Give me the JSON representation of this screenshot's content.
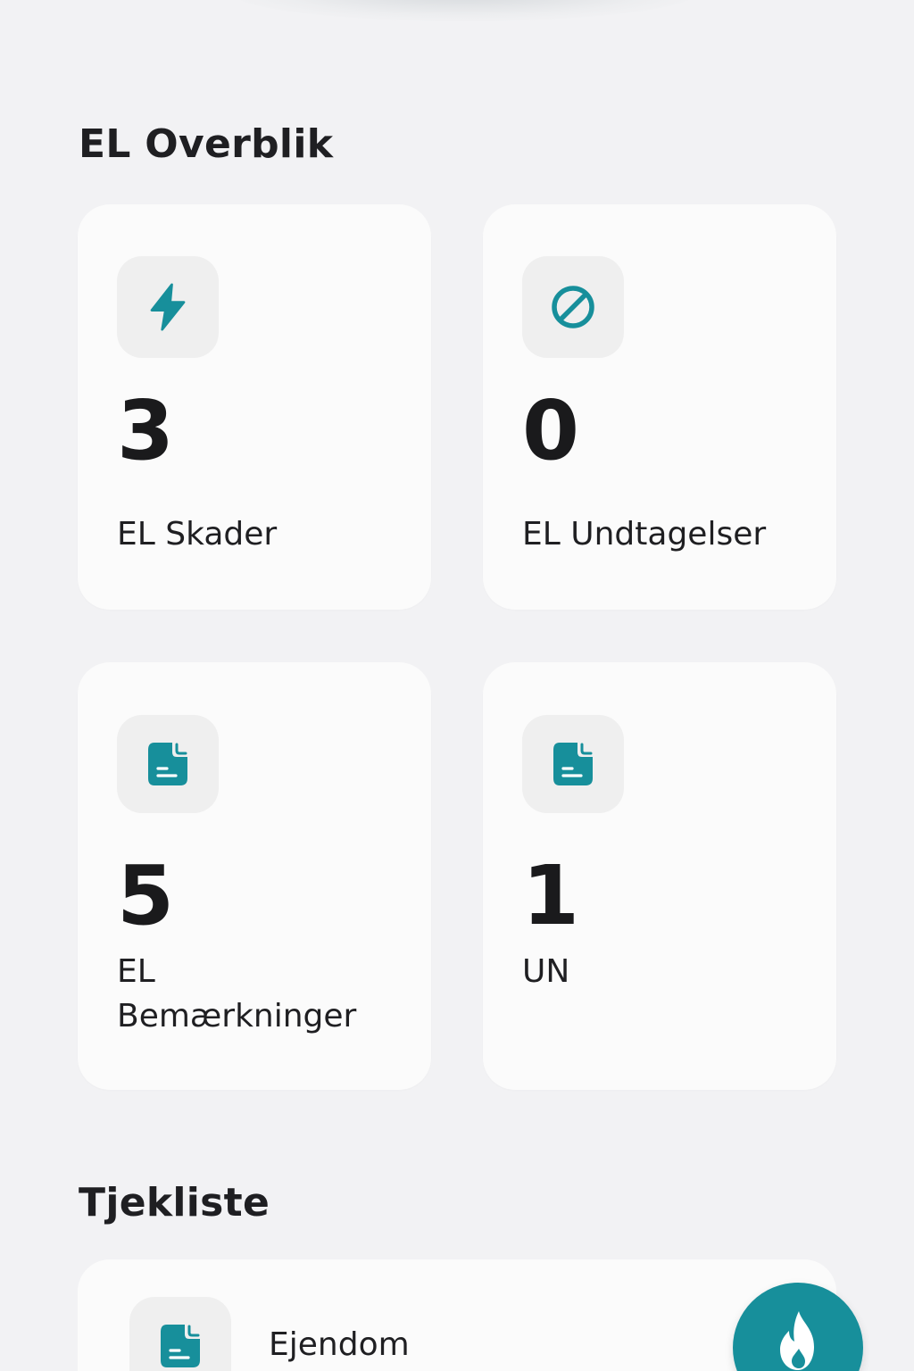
{
  "overview": {
    "title": "EL Overblik",
    "cards": [
      {
        "icon": "lightning-bolt-icon",
        "count": "3",
        "label": "EL Skader"
      },
      {
        "icon": "prohibited-icon",
        "count": "0",
        "label": "EL Undtagelser"
      },
      {
        "icon": "document-icon",
        "count": "5",
        "label": "EL Bemærkninger"
      },
      {
        "icon": "document-icon",
        "count": "1",
        "label": "UN"
      }
    ]
  },
  "checklist": {
    "title": "Tjekliste",
    "items": [
      {
        "icon": "document-icon",
        "label": "Ejendom"
      }
    ]
  },
  "fab": {
    "icon": "flame-icon"
  },
  "colors": {
    "accent": "#178f9b",
    "background": "#f2f2f4",
    "card": "#fbfbfb",
    "icon_tile": "#efefef",
    "text": "#1f1f22"
  }
}
